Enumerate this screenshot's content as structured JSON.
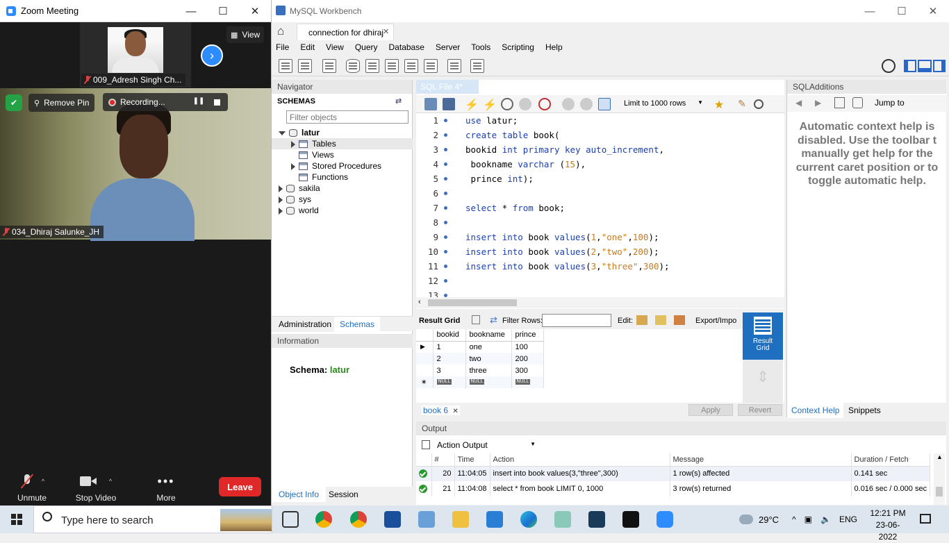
{
  "zoom": {
    "title": "Zoom Meeting",
    "thumb_name": "009_Adresh Singh Ch...",
    "view_label": "View",
    "remove_pin": "Remove Pin",
    "recording": "Recording...",
    "main_name": "034_Dhiraj Salunke_JH",
    "unmute": "Unmute",
    "stop_video": "Stop Video",
    "more": "More",
    "leave": "Leave"
  },
  "workbench": {
    "title": "MySQL Workbench",
    "connection_tab": "connection for dhiraj",
    "menu": [
      "File",
      "Edit",
      "View",
      "Query",
      "Database",
      "Server",
      "Tools",
      "Scripting",
      "Help"
    ],
    "navigator": {
      "header": "Navigator",
      "schemas_label": "SCHEMAS",
      "filter_placeholder": "Filter objects",
      "schemas": [
        "latur",
        "sakila",
        "sys",
        "world"
      ],
      "latur_children": [
        "Tables",
        "Views",
        "Stored Procedures",
        "Functions"
      ],
      "tabs": [
        "Administration",
        "Schemas"
      ],
      "info_header": "Information",
      "schema_label": "Schema:",
      "schema_value": "latur",
      "bottom_tabs": [
        "Object Info",
        "Session"
      ]
    },
    "editor": {
      "tab": "SQL File 4*",
      "limit": "Limit to 1000 rows",
      "lines": [
        "use latur;",
        "create table book(",
        "bookid int primary key auto_increment,",
        " bookname varchar (15),",
        " prince int);",
        "",
        "select * from book;",
        "",
        "insert into book values(1,\"one\",100);",
        "insert into book values(2,\"two\",200);",
        "insert into book values(3,\"three\",300);",
        "",
        ""
      ]
    },
    "result": {
      "result_grid": "Result Grid",
      "filter_rows": "Filter Rows:",
      "edit": "Edit:",
      "export": "Export/Impo",
      "columns": [
        "bookid",
        "bookname",
        "prince"
      ],
      "rows": [
        [
          "1",
          "one",
          "100"
        ],
        [
          "2",
          "two",
          "200"
        ],
        [
          "3",
          "three",
          "300"
        ]
      ],
      "null": "NULL",
      "side_button": "Result Grid",
      "tab": "book 6",
      "apply": "Apply",
      "revert": "Revert"
    },
    "sql_additions": {
      "header": "SQLAdditions",
      "jump_to": "Jump to",
      "help_text": "Automatic context help is disabled. Use the toolbar to manually get help for the current caret position or to toggle automatic help.",
      "help_lines": [
        "Automatic context help is",
        "disabled. Use the toolbar t",
        "manually get help for the",
        "current caret position or to",
        "toggle automatic help."
      ],
      "tabs": [
        "Context Help",
        "Snippets"
      ]
    },
    "output": {
      "header": "Output",
      "dropdown": "Action Output",
      "columns": [
        "#",
        "Time",
        "Action",
        "Message",
        "Duration / Fetch"
      ],
      "rows": [
        [
          "20",
          "11:04:05",
          "insert into book values(3,\"three\",300)",
          "1 row(s) affected",
          "0.141 sec"
        ],
        [
          "21",
          "11:04:08",
          "select * from book LIMIT 0, 1000",
          "3 row(s) returned",
          "0.016 sec / 0.000 sec"
        ]
      ]
    }
  },
  "taskbar": {
    "search": "Type here to search",
    "weather": "29°C",
    "lang": "ENG",
    "time": "12:21 PM",
    "date": "23-06-2022"
  },
  "colors": {
    "accent": "#1e6fc0",
    "zoom_leave": "#e02828",
    "schema_green": "#2a8a1a"
  }
}
